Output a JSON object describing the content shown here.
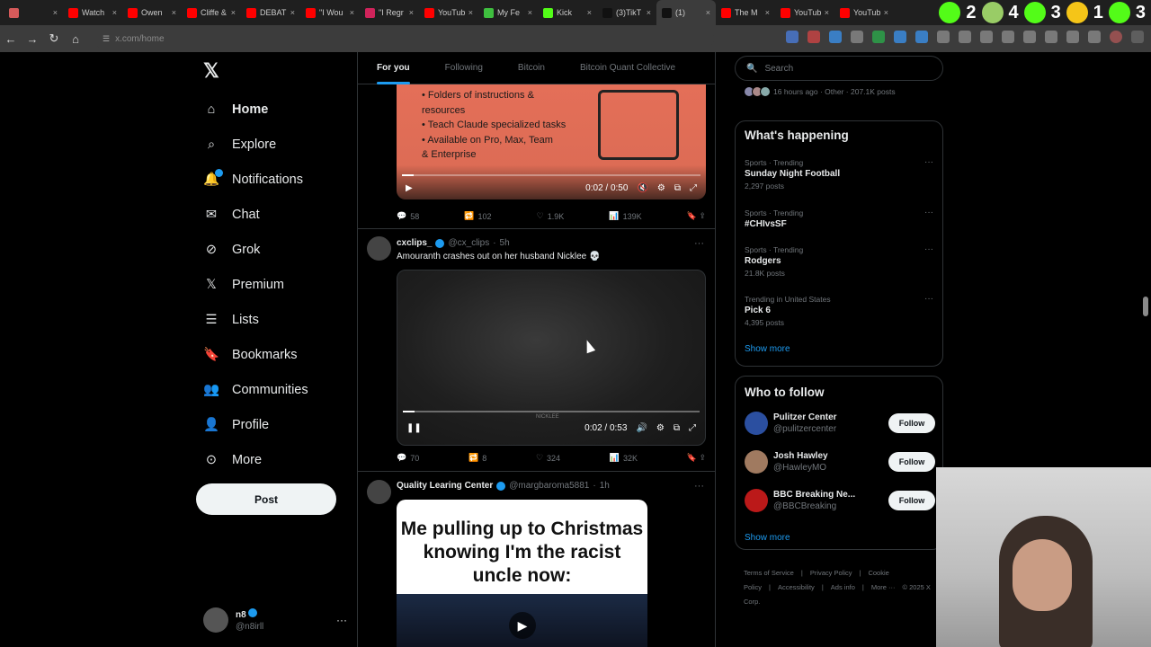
{
  "browser": {
    "tabs": [
      {
        "label": "",
        "color": "#d65a5a",
        "active": false
      },
      {
        "label": "Watch",
        "color": "#ff0000",
        "active": false
      },
      {
        "label": "Owen",
        "color": "#ff0000",
        "active": false
      },
      {
        "label": "Cliffe &",
        "color": "#ff0000",
        "active": false
      },
      {
        "label": "DEBAT",
        "color": "#ff0000",
        "active": false
      },
      {
        "label": "\"I Wou",
        "color": "#ff0000",
        "active": false
      },
      {
        "label": "\"I Regr",
        "color": "#d0245b",
        "active": false
      },
      {
        "label": "YouTub",
        "color": "#ff0000",
        "active": false
      },
      {
        "label": "My Fe",
        "color": "#3fbf3f",
        "active": false
      },
      {
        "label": "Kick",
        "color": "#53fc18",
        "active": false
      },
      {
        "label": "(3)TikT",
        "color": "#111111",
        "active": false
      },
      {
        "label": "(1)",
        "color": "#111111",
        "active": true
      },
      {
        "label": "The M",
        "color": "#ff0000",
        "active": false
      },
      {
        "label": "YouTub",
        "color": "#ff0000",
        "active": false
      },
      {
        "label": "YouTub",
        "color": "#ff0000",
        "active": false
      }
    ],
    "ext_counts": [
      "2",
      "4",
      "3",
      "1",
      "3"
    ],
    "url_dim": "x.com",
    "url_path": "/home"
  },
  "nav": {
    "items": [
      {
        "label": "Home",
        "icon": "home-icon",
        "bold": true
      },
      {
        "label": "Explore",
        "icon": "search-icon",
        "bold": false
      },
      {
        "label": "Notifications",
        "icon": "bell-icon",
        "bold": false
      },
      {
        "label": "Chat",
        "icon": "mail-icon",
        "bold": false
      },
      {
        "label": "Grok",
        "icon": "grok-icon",
        "bold": false
      },
      {
        "label": "Premium",
        "icon": "x-icon",
        "bold": false
      },
      {
        "label": "Lists",
        "icon": "list-icon",
        "bold": false
      },
      {
        "label": "Bookmarks",
        "icon": "bookmark-icon",
        "bold": false
      },
      {
        "label": "Communities",
        "icon": "people-icon",
        "bold": false
      },
      {
        "label": "Profile",
        "icon": "person-icon",
        "bold": false
      },
      {
        "label": "More",
        "icon": "more-icon",
        "bold": false
      }
    ],
    "post_label": "Post",
    "account": {
      "name": "n8",
      "handle": "@n8irll"
    }
  },
  "feed": {
    "tabs": [
      "For you",
      "Following",
      "Bitcoin",
      "Bitcoin Quant Collective"
    ],
    "post1": {
      "bullets": [
        "Folders of instructions &\nresources",
        "Teach Claude specialized tasks",
        "Available on Pro, Max, Team\n& Enterprise"
      ],
      "time": "0:02 / 0:50",
      "progress": 0.04,
      "replies": "58",
      "reposts": "102",
      "likes": "1.9K",
      "views": "139K"
    },
    "post2": {
      "name": "cxclips_",
      "handle": "@cx_clips",
      "age": "5h",
      "text": "Amouranth crashes out on her husband Nicklee 💀",
      "watermark": "NICKLEE",
      "time": "0:02 / 0:53",
      "progress": 0.04,
      "replies": "70",
      "reposts": "8",
      "likes": "324",
      "views": "32K"
    },
    "post3": {
      "name": "Quality Learing Center",
      "handle": "@margbaroma5881",
      "age": "1h",
      "meme": "Me pulling up to Christmas knowing I'm the racist uncle now:"
    }
  },
  "right": {
    "search_placeholder": "Search",
    "top_meta": "16 hours ago · Other · 207.1K posts",
    "happening_title": "What's happening",
    "trends": [
      {
        "context": "Sports · Trending",
        "name": "Sunday Night Football",
        "count": "2,297 posts"
      },
      {
        "context": "Sports · Trending",
        "name": "#CHIvsSF",
        "count": ""
      },
      {
        "context": "Sports · Trending",
        "name": "Rodgers",
        "count": "21.8K posts"
      },
      {
        "context": "Trending in United States",
        "name": "Pick 6",
        "count": "4,395 posts"
      }
    ],
    "show_more": "Show more",
    "wtf_title": "Who to follow",
    "follows": [
      {
        "name": "Pulitzer Center",
        "handle": "@pulitzercenter",
        "avatar_color": "#2b4fa0"
      },
      {
        "name": "Josh Hawley",
        "handle": "@HawleyMO",
        "avatar_color": "#a07a60"
      },
      {
        "name": "BBC Breaking Ne...",
        "handle": "@BBCBreaking",
        "avatar_color": "#bb1919"
      }
    ],
    "follow_label": "Follow",
    "footer": [
      "Terms of Service",
      "|",
      "Privacy Policy",
      "|",
      "Cookie Policy",
      "|",
      "Accessibility",
      "|",
      "Ads info",
      "|",
      "More ···",
      "© 2025 X Corp."
    ]
  },
  "colors": {
    "accent": "#1d9bf0",
    "bg": "#000000",
    "border": "#2f3336",
    "muted": "#71767b"
  }
}
